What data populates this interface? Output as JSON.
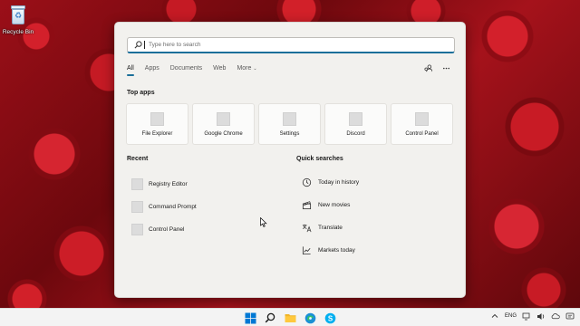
{
  "desktop": {
    "recycle_bin_label": "Recycle Bin"
  },
  "search": {
    "placeholder": "Type here to search"
  },
  "tabs": [
    {
      "label": "All"
    },
    {
      "label": "Apps"
    },
    {
      "label": "Documents"
    },
    {
      "label": "Web"
    },
    {
      "label": "More"
    }
  ],
  "top_apps": {
    "title": "Top apps",
    "items": [
      {
        "label": "File Explorer"
      },
      {
        "label": "Google Chrome"
      },
      {
        "label": "Settings"
      },
      {
        "label": "Discord"
      },
      {
        "label": "Control Panel"
      }
    ]
  },
  "recent": {
    "title": "Recent",
    "items": [
      {
        "label": "Registry Editor"
      },
      {
        "label": "Command Prompt"
      },
      {
        "label": "Control Panel"
      }
    ]
  },
  "quick_searches": {
    "title": "Quick searches",
    "items": [
      {
        "label": "Today in history",
        "icon": "clock-icon"
      },
      {
        "label": "New movies",
        "icon": "clapperboard-icon"
      },
      {
        "label": "Translate",
        "icon": "translate-icon"
      },
      {
        "label": "Markets today",
        "icon": "chart-icon"
      }
    ]
  },
  "taskbar": {
    "language": "ENG"
  },
  "colors": {
    "accent": "#1c6f9a",
    "panel_bg": "#f2f1ee",
    "taskbar_bg": "#f3f3f3",
    "windows_blue": "#0078d4"
  }
}
